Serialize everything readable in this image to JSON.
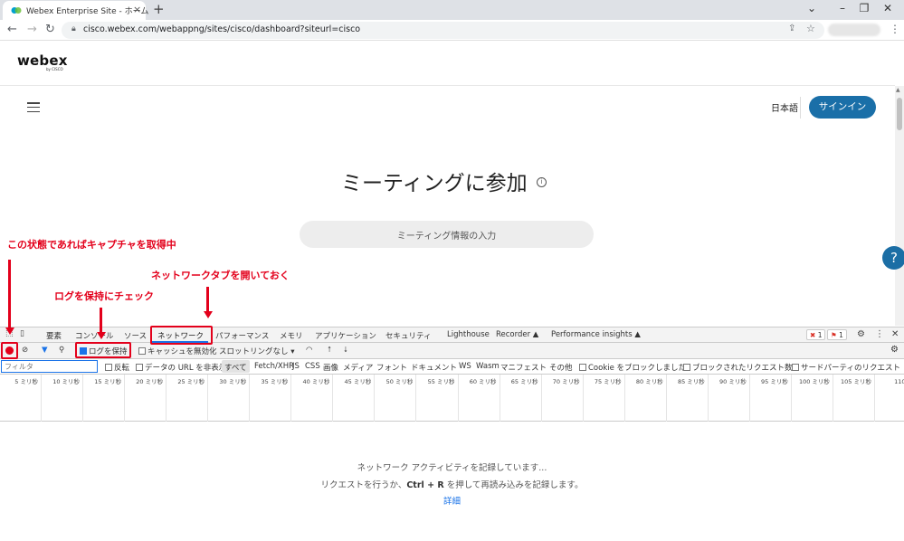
{
  "browser": {
    "tab_title": "Webex Enterprise Site - ホーム",
    "url": "cisco.webex.com/webappng/sites/cisco/dashboard?siteurl=cisco"
  },
  "site": {
    "logo": "webex",
    "logo_sub": "by CISCO",
    "language": "日本語",
    "signin": "サインイン",
    "join_title": "ミーティングに参加",
    "meeting_placeholder": "ミーティング情報の入力",
    "help": "?"
  },
  "annotations": {
    "capture_note": "この状態であればキャプチャを取得中",
    "network_tab_note": "ネットワークタブを開いておく",
    "preserve_log_note": "ログを保持にチェック"
  },
  "devtools": {
    "tabs": [
      "要素",
      "コンソール",
      "ソース",
      "ネットワーク",
      "パフォーマンス",
      "メモリ",
      "アプリケーション",
      "セキュリティ",
      "Lighthouse",
      "Recorder ▲",
      "Performance insights ▲"
    ],
    "error_count": "1",
    "issue_count": "1",
    "toolbar": {
      "preserve_log": "ログを保持",
      "disable_cache": "キャッシュを無効化",
      "throttling": "スロットリングなし"
    },
    "filter": {
      "placeholder": "フィルタ",
      "invert": "反転",
      "hide_data_urls": "データの URL を非表示",
      "types": [
        "すべて",
        "Fetch/XHR",
        "JS",
        "CSS",
        "画像",
        "メディア",
        "フォント",
        "ドキュメント",
        "WS",
        "Wasm",
        "マニフェスト",
        "その他"
      ],
      "blocked_cookies": "Cookie をブロックしました",
      "blocked_requests": "ブロックされたリクエスト数",
      "third_party": "サードパーティのリクエスト"
    },
    "timeline_ticks": [
      "5 ミリ秒",
      "10 ミリ秒",
      "15 ミリ秒",
      "20 ミリ秒",
      "25 ミリ秒",
      "30 ミリ秒",
      "35 ミリ秒",
      "40 ミリ秒",
      "45 ミリ秒",
      "50 ミリ秒",
      "55 ミリ秒",
      "60 ミリ秒",
      "65 ミリ秒",
      "70 ミリ秒",
      "75 ミリ秒",
      "80 ミリ秒",
      "85 ミリ秒",
      "90 ミリ秒",
      "95 ミリ秒",
      "100 ミリ秒",
      "105 ミリ秒",
      "110 ミ"
    ],
    "empty": {
      "line1": "ネットワーク アクティビティを記録しています...",
      "line2_pre": "リクエストを行うか、",
      "line2_key": "Ctrl + R",
      "line2_post": " を押して再読み込みを記録します。",
      "details": "詳細"
    }
  }
}
